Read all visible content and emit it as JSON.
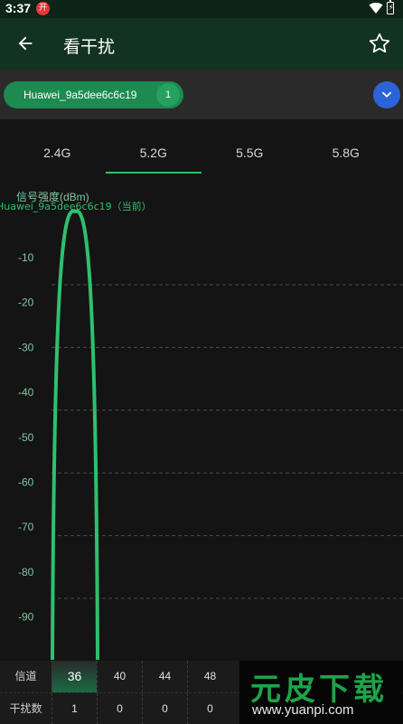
{
  "status_bar": {
    "time": "3:37",
    "app_icon_glyph": "开"
  },
  "app_bar": {
    "title": "看干扰",
    "back_icon": "arrow-back-icon",
    "favorite_icon": "star-outline-icon"
  },
  "network": {
    "selected_ssid": "Huawei_9a5dee6c6c19",
    "count": "1"
  },
  "tabs": [
    {
      "label": "2.4G",
      "active": false
    },
    {
      "label": "5.2G",
      "active": true
    },
    {
      "label": "5.5G",
      "active": false
    },
    {
      "label": "5.8G",
      "active": false
    }
  ],
  "chart_data": {
    "type": "line",
    "ylabel": "信号强度(dBm)",
    "y_ticks": [
      "-10",
      "-20",
      "-30",
      "-40",
      "-50",
      "-60",
      "-70",
      "-80",
      "-90"
    ],
    "ylim": [
      -100,
      0
    ],
    "grid": true,
    "series": [
      {
        "name": "Huawei_9a5dee6c6c19（当前）",
        "channel": 36,
        "peak_dbm": -1,
        "color": "#2fbf6e"
      }
    ]
  },
  "table": {
    "channel_header": "信道",
    "interference_header": "干扰数",
    "channels": [
      "36",
      "40",
      "44",
      "48"
    ],
    "interference": [
      "1",
      "0",
      "0",
      "0"
    ],
    "selected_channel_index": 0
  },
  "watermark": {
    "title": "元皮下载",
    "url": "www.yuanpi.com"
  },
  "colors": {
    "accent": "#2fbf6e",
    "app_bar": "#123322",
    "expand_button": "#2d63d8"
  }
}
